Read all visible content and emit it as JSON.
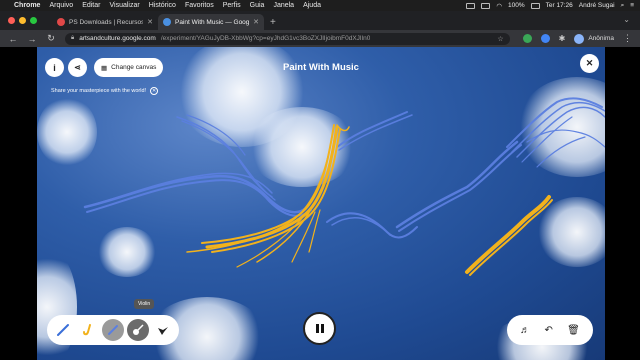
{
  "menubar": {
    "app": "Chrome",
    "items": [
      "Arquivo",
      "Editar",
      "Visualizar",
      "Histórico",
      "Favoritos",
      "Perfis",
      "Guia",
      "Janela",
      "Ajuda"
    ],
    "battery": "100%",
    "clock": "Ter 17:26",
    "user": "André Sugai"
  },
  "tabs": [
    {
      "label": "PS Downloads | Recursos grá",
      "favicon_color": "#e04848",
      "active": false
    },
    {
      "label": "Paint With Music — Google",
      "favicon_color": "#4a90e2",
      "active": true
    }
  ],
  "toolbar": {
    "url_host": "artsandculture.google.com",
    "url_rest": "/experiment/YAGuJyDB-XbbWg?cp=eyJhdG1vc3BoZXJlIjoibmF0dXJlIn0",
    "profile": "Anônima"
  },
  "app": {
    "title": "Paint With Music",
    "change_canvas": "Change canvas",
    "share_note": "Share your masterpiece with the world!",
    "tooltip": "Violin",
    "info_icon": "info-icon",
    "share_icon": "share-icon",
    "close_icon": "close-icon",
    "instruments": [
      "flute-icon",
      "saxophone-icon",
      "violin-icon",
      "guitar-icon",
      "bird-icon"
    ],
    "actions": [
      "score-icon",
      "undo-icon",
      "delete-icon"
    ]
  },
  "colors": {
    "sky": "#2f5ea9",
    "blue_stroke": "#5b7fe0",
    "yellow_stroke": "#f2b21c"
  }
}
